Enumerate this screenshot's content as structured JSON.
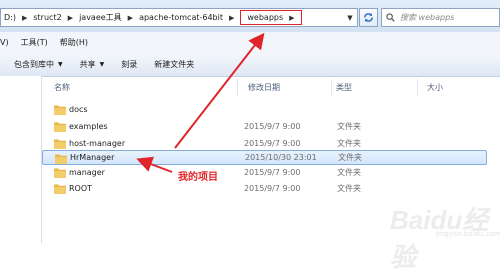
{
  "address_bar": {
    "crumbs": [
      {
        "label": "D:)"
      },
      {
        "label": "struct2"
      },
      {
        "label": "javaee工具"
      },
      {
        "label": "apache-tomcat-64bit"
      },
      {
        "label": "webapps"
      }
    ],
    "search_placeholder": "搜索 webapps"
  },
  "menu": {
    "items": [
      "V)",
      "工具(T)",
      "帮助(H)"
    ]
  },
  "toolbar": {
    "include_library": "包含到库中",
    "share": "共享",
    "burn": "刻录",
    "new_folder": "新建文件夹"
  },
  "columns": {
    "name": "名称",
    "modified": "修改日期",
    "type": "类型",
    "size": "大小"
  },
  "files": [
    {
      "name": "docs",
      "modified": "2015/9/7 9:00",
      "type": "文件夹"
    },
    {
      "name": "examples",
      "modified": "2015/9/7 9:00",
      "type": "文件夹"
    },
    {
      "name": "host-manager",
      "modified": "2015/9/7 9:00",
      "type": "文件夹"
    },
    {
      "name": "HrManager",
      "modified": "2015/10/30 23:01",
      "type": "文件夹"
    },
    {
      "name": "manager",
      "modified": "2015/9/7 9:00",
      "type": "文件夹"
    },
    {
      "name": "ROOT",
      "modified": "2015/9/7 9:00",
      "type": "文件夹"
    }
  ],
  "annotation": {
    "label": "我的项目",
    "color": "#e0252a"
  },
  "watermark": {
    "text": "Baidu经验",
    "sub": "jingyan.baidu.com"
  }
}
